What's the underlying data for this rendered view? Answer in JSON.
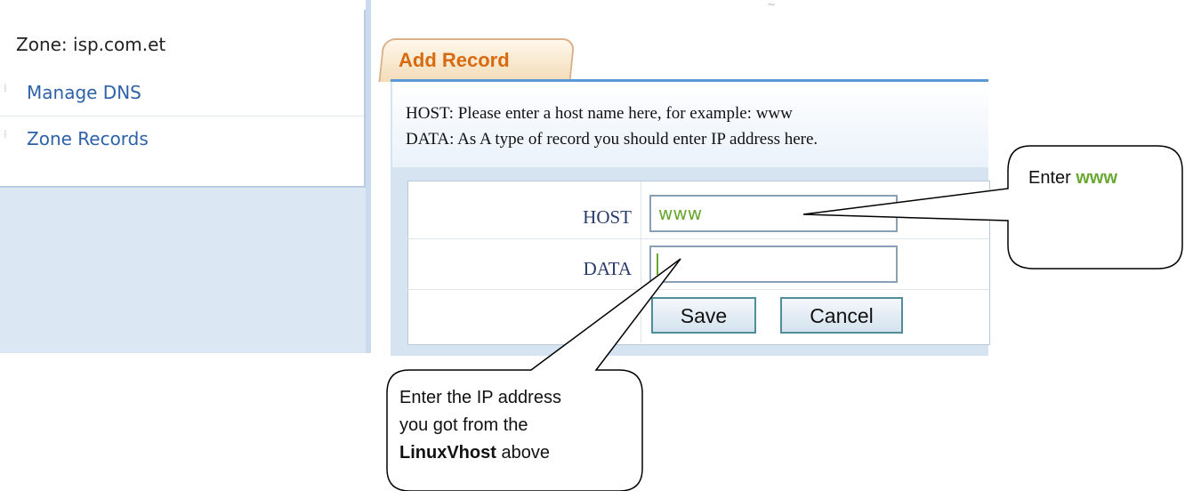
{
  "sidebar": {
    "zone_label": "Zone: isp.com.et",
    "items": [
      {
        "label": "Manage DNS",
        "icon": "dotted-bullet-icon"
      },
      {
        "label": "Zone Records",
        "icon": "dotted-bullet-icon"
      }
    ]
  },
  "tab": {
    "label": "Add Record"
  },
  "info": {
    "line1": "HOST: Please enter a host name here, for example: www",
    "line2": "DATA: As A type of record you should enter IP address here."
  },
  "form": {
    "host_label": "HOST",
    "host_value": "www",
    "data_label": "DATA",
    "data_value": "",
    "save_label": "Save",
    "cancel_label": "Cancel"
  },
  "callouts": {
    "right_prefix": "Enter ",
    "right_highlight": "www",
    "bottom_line1": "Enter the IP address",
    "bottom_line2": "you got from the",
    "bottom_bold": "LinuxVhost",
    "bottom_suffix": " above"
  },
  "colors": {
    "accent_green": "#6aa832",
    "tab_text": "#d86a10",
    "link_blue": "#2e62a8",
    "panel_border": "#5d98d6"
  }
}
